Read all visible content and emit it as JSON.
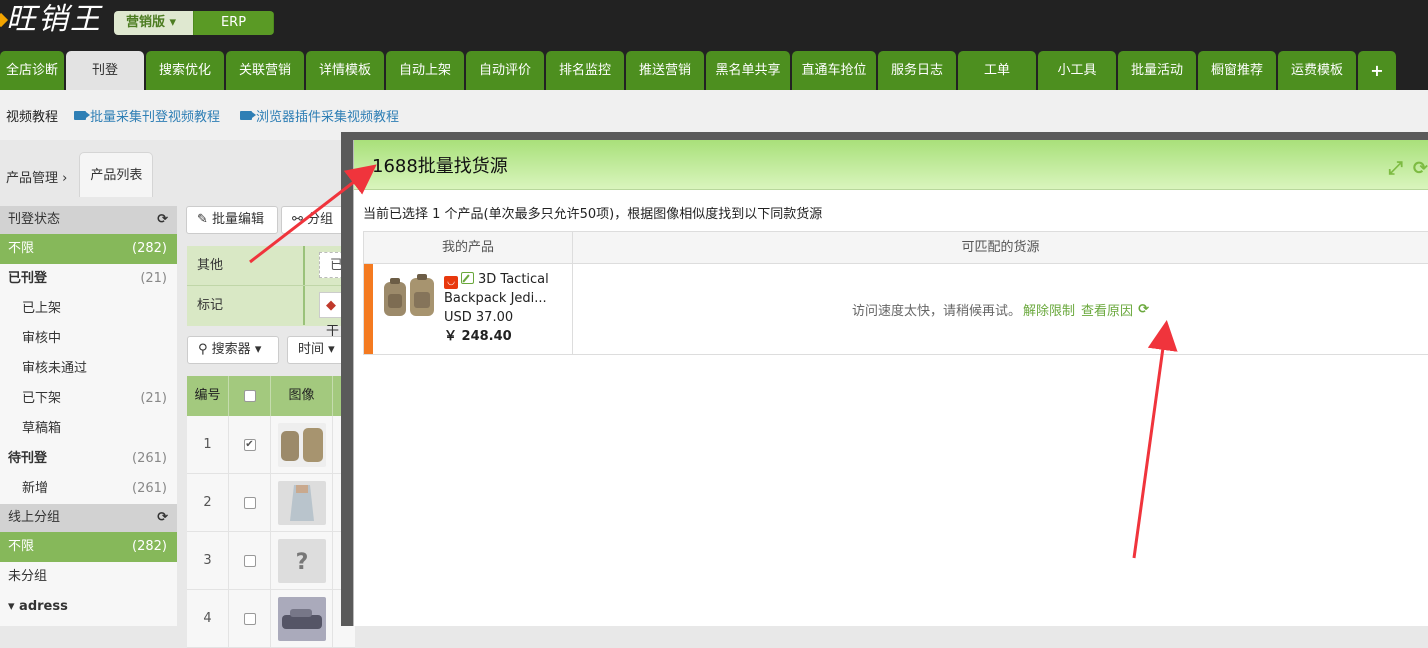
{
  "app": {
    "logo_text": "旺销王",
    "edition_selected": "营销版",
    "edition_other": "ERP"
  },
  "nav": {
    "tabs": [
      {
        "label": "全店诊断",
        "w": 64
      },
      {
        "label": "刊登",
        "w": 78,
        "active": true
      },
      {
        "label": "搜索优化",
        "w": 78
      },
      {
        "label": "关联营销",
        "w": 78
      },
      {
        "label": "详情模板",
        "w": 78
      },
      {
        "label": "自动上架",
        "w": 78
      },
      {
        "label": "自动评价",
        "w": 78
      },
      {
        "label": "排名监控",
        "w": 78
      },
      {
        "label": "推送营销",
        "w": 78
      },
      {
        "label": "黑名单共享",
        "w": 84
      },
      {
        "label": "直通车抢位",
        "w": 84
      },
      {
        "label": "服务日志",
        "w": 78
      },
      {
        "label": "工单",
        "w": 78
      },
      {
        "label": "小工具",
        "w": 78
      },
      {
        "label": "批量活动",
        "w": 78
      },
      {
        "label": "橱窗推荐",
        "w": 78
      },
      {
        "label": "运费模板",
        "w": 78
      },
      {
        "label": "+",
        "w": 38
      }
    ]
  },
  "subbar": {
    "label": "视频教程",
    "link1": "批量采集刊登视频教程",
    "link2": "浏览器插件采集视频教程"
  },
  "breadcrumb": {
    "root": "产品管理",
    "sep": "›",
    "current": "产品列表"
  },
  "sidebar": {
    "section1": "刊登状态",
    "section2": "线上分组",
    "items1": [
      {
        "label": "不限",
        "count": "(282)",
        "sel": true
      },
      {
        "label": "已刊登",
        "count": "(21)",
        "bold": true
      },
      {
        "label": "已上架",
        "count": "",
        "sub": true
      },
      {
        "label": "审核中",
        "count": "",
        "sub": true
      },
      {
        "label": "审核未通过",
        "count": "",
        "sub": true
      },
      {
        "label": "已下架",
        "count": "(21)",
        "sub": true
      },
      {
        "label": "草稿箱",
        "count": "",
        "sub": true
      },
      {
        "label": "待刊登",
        "count": "(261)",
        "bold": true
      },
      {
        "label": "新增",
        "count": "(261)",
        "sub": true
      }
    ],
    "items2": [
      {
        "label": "不限",
        "count": "(282)",
        "sel": true
      },
      {
        "label": "未分组",
        "count": ""
      },
      {
        "label": "▾ adress",
        "count": "",
        "bold": true
      }
    ]
  },
  "toolbar": {
    "batch_edit": "批量编辑",
    "group": "分组",
    "search": "搜索器",
    "time": "时间"
  },
  "filters": {
    "row1": "其他",
    "row2": "标记",
    "row1_partial": "已",
    "row2_tag_partial": "干"
  },
  "grid": {
    "headers": [
      "编号",
      "",
      "图像"
    ],
    "rows": [
      {
        "no": "1",
        "checked": true,
        "img": "backpack"
      },
      {
        "no": "2",
        "checked": false,
        "img": "dress"
      },
      {
        "no": "3",
        "checked": false,
        "img": "unknown"
      },
      {
        "no": "4",
        "checked": false,
        "img": "car"
      }
    ]
  },
  "modal": {
    "title": "1688批量找货源",
    "info": "当前已选择 1 个产品(单次最多只允许50项)，根据图像相似度找到以下同款货源",
    "col_mine": "我的产品",
    "col_match": "可匹配的货源",
    "product": {
      "title": "3D Tactical Backpack Jedi...",
      "price_usd": "USD 37.00",
      "price_cny": "￥ 248.40"
    },
    "match_msg": "访问速度太快，请稍候再试。",
    "link_unlock": "解除限制",
    "link_reason": "查看原因"
  },
  "colors": {
    "accent": "#4d8f1f",
    "modal_head": "#a9e07a",
    "arrow": "#f0343c"
  }
}
